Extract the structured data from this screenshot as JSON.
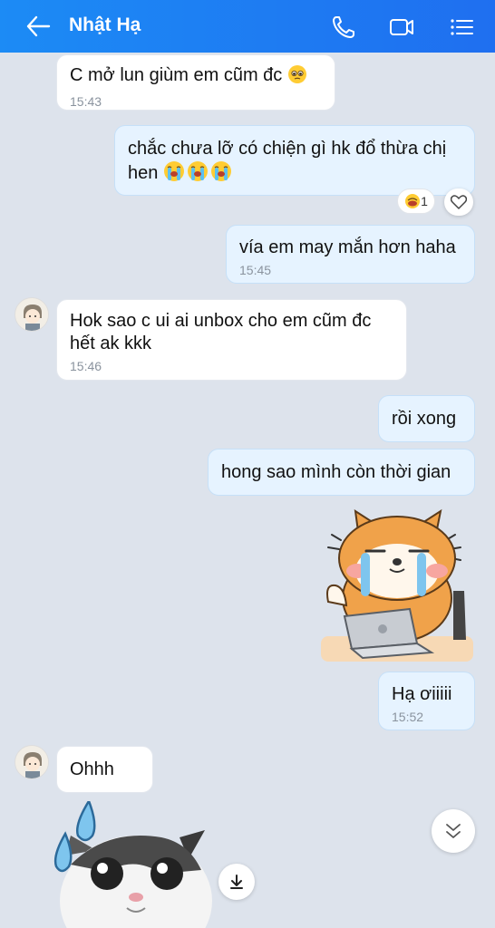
{
  "header": {
    "title": "Nhật Hạ",
    "icons": [
      "back-arrow-icon",
      "phone-icon",
      "video-call-icon",
      "menu-icon"
    ]
  },
  "messages": [
    {
      "direction": "in",
      "text": "C mở lun giùm em cũm đc",
      "emoji": "pleading-face",
      "time": "15:43"
    },
    {
      "direction": "out",
      "line1": "chắc chưa lỡ có chiện gì hk đổ thừa chị",
      "line2": "hen",
      "emoji": "crying-face",
      "reaction_count": "1"
    },
    {
      "direction": "out",
      "text": "vía em may mắn hơn haha",
      "time": "15:45"
    },
    {
      "direction": "in",
      "line1": "Hok sao c ui ai unbox cho em cũm đc",
      "line2": "hết ak kkk",
      "time": "15:46"
    },
    {
      "direction": "out",
      "text": "rồi xong"
    },
    {
      "direction": "out",
      "text": "hong sao mình còn thời gian"
    },
    {
      "direction": "out",
      "type": "sticker",
      "sticker": "shiba-crying-laptop"
    },
    {
      "direction": "out",
      "text": "Hạ ơiiiii",
      "time": "15:52"
    },
    {
      "direction": "in",
      "text": "Ohhh"
    },
    {
      "direction": "in",
      "type": "sticker",
      "sticker": "cat-sweat-drops"
    }
  ],
  "colors": {
    "header": "#1f7ef2",
    "background": "#dde3ec",
    "out_bubble": "#e6f3ff",
    "in_bubble": "#ffffff"
  }
}
